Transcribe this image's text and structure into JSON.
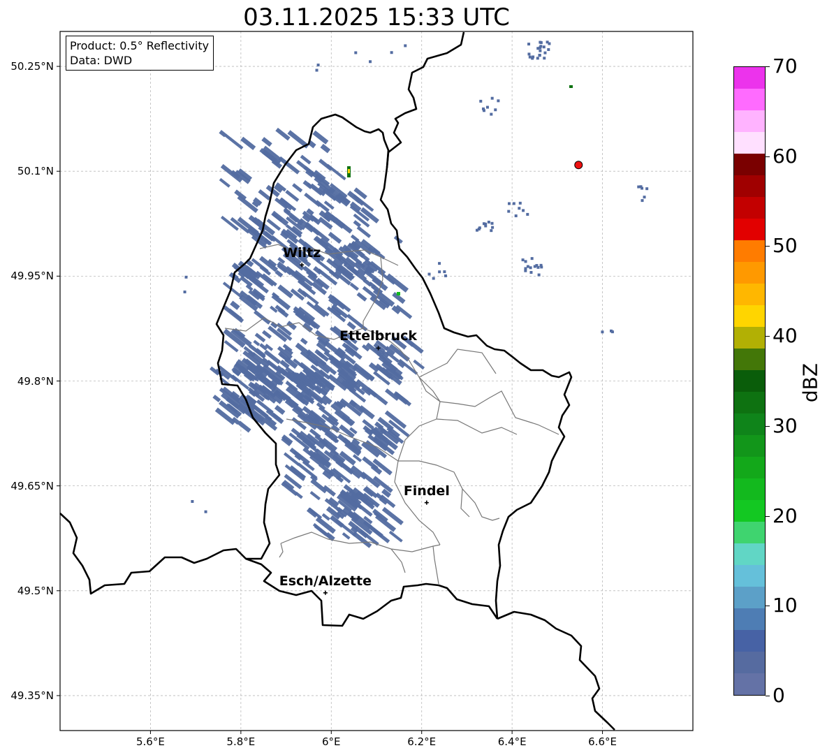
{
  "title": "03.11.2025 15:33 UTC",
  "info": {
    "product": "Product: 0.5° Reflectivity",
    "data": "Data: DWD"
  },
  "lat_ticks": [
    {
      "value": 50.25,
      "label": "50.25°N"
    },
    {
      "value": 50.1,
      "label": "50.1°N"
    },
    {
      "value": 49.95,
      "label": "49.95°N"
    },
    {
      "value": 49.8,
      "label": "49.8°N"
    },
    {
      "value": 49.65,
      "label": "49.65°N"
    },
    {
      "value": 49.5,
      "label": "49.5°N"
    },
    {
      "value": 49.35,
      "label": "49.35°N"
    }
  ],
  "lon_ticks": [
    {
      "value": 5.6,
      "label": "5.6°E"
    },
    {
      "value": 5.8,
      "label": "5.8°E"
    },
    {
      "value": 6.0,
      "label": "6°E"
    },
    {
      "value": 6.2,
      "label": "6.2°E"
    },
    {
      "value": 6.4,
      "label": "6.4°E"
    },
    {
      "value": 6.6,
      "label": "6.6°E"
    }
  ],
  "map_extent": {
    "lon_min": 5.4,
    "lon_max": 6.8,
    "lat_min": 49.3,
    "lat_max": 50.3
  },
  "cities": [
    {
      "name": "Wiltz",
      "lon": 5.935,
      "lat": 49.966
    },
    {
      "name": "Ettelbruck",
      "lon": 6.104,
      "lat": 49.847
    },
    {
      "name": "Findel",
      "lon": 6.211,
      "lat": 49.626
    },
    {
      "name": "Esch/Alzette",
      "lon": 5.987,
      "lat": 49.497
    }
  ],
  "radar_site": {
    "lon": 6.547,
    "lat": 50.109,
    "color": "#ee1111"
  },
  "colorbar": {
    "label": "dBZ",
    "min": 0,
    "max": 70,
    "ticks": [
      "0",
      "10",
      "20",
      "30",
      "40",
      "50",
      "60",
      "70"
    ],
    "colors": [
      "#6472a6",
      "#566ba0",
      "#4762a5",
      "#4e7db4",
      "#5ca0c8",
      "#65c0da",
      "#61d6c5",
      "#3fd46f",
      "#13c822",
      "#13b91e",
      "#13a81a",
      "#12961a",
      "#0f841a",
      "#0e7211",
      "#0a5d0a",
      "#437708",
      "#b2b004",
      "#ffd500",
      "#ffb700",
      "#ff9900",
      "#ff7c00",
      "#e20000",
      "#c30000",
      "#a00000",
      "#7a0000",
      "#ffe0ff",
      "#ffb3ff",
      "#ff6bff",
      "#ec33ec"
    ]
  },
  "precip_color": "#536ca1"
}
